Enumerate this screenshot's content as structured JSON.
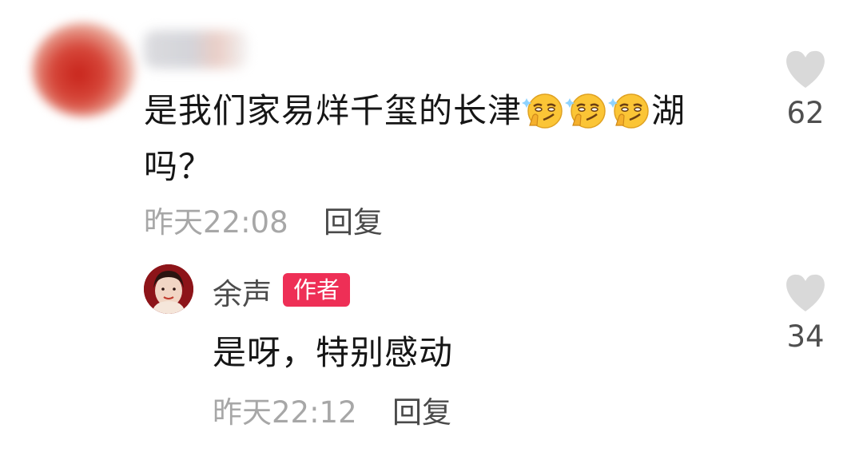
{
  "comment": {
    "user_name": "",
    "text_before": "是我们家易烊千玺的长津",
    "emoji_name": "smirk-emoji",
    "emoji_count": 3,
    "text_after": "湖",
    "text_line2": "吗？",
    "timestamp": "昨天22:08",
    "reply_label": "回复",
    "like_count": "62",
    "like_icon": "heart-icon"
  },
  "reply": {
    "user_name": "余声",
    "author_badge": "作者",
    "text": "是呀，特别感动",
    "timestamp": "昨天22:12",
    "reply_label": "回复",
    "like_count": "34",
    "like_icon": "heart-icon"
  },
  "colors": {
    "badge_bg": "#ee2f56",
    "heart": "#d9d9d9",
    "meta_text": "#a7a7a7"
  }
}
